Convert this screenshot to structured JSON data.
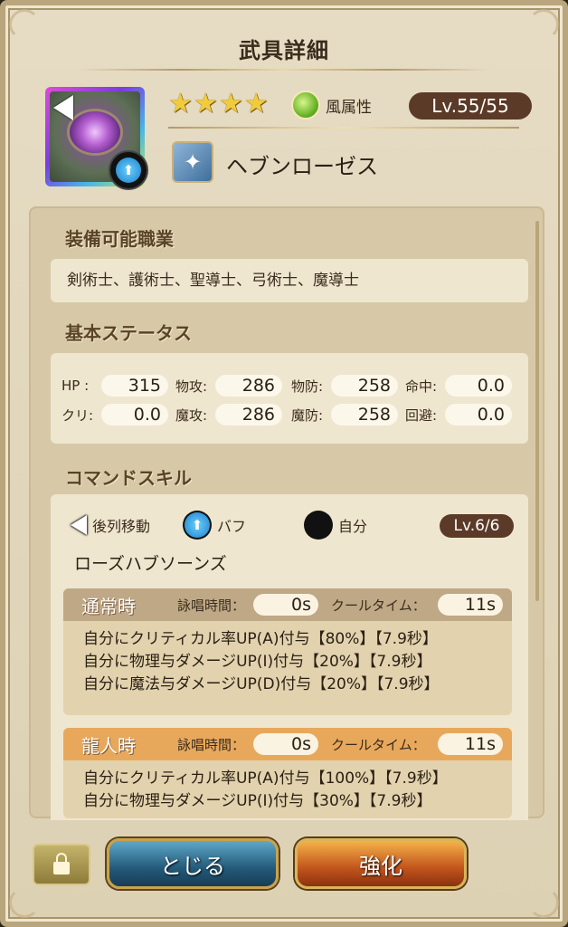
{
  "title": "武具詳細",
  "weapon": {
    "name": "ヘブンローゼス",
    "rarity_stars": 4,
    "star_glyph": "★",
    "attribute": "風属性",
    "level": "Lv.55/55",
    "icon": "rose-weapon-icon"
  },
  "sections": {
    "jobs_title": "装備可能職業",
    "stats_title": "基本ステータス",
    "skill_title": "コマンドスキル"
  },
  "jobs": "剣術士、護術士、聖導士、弓術士、魔導士",
  "stats": [
    {
      "label": "HP :",
      "value": "315"
    },
    {
      "label": "物攻:",
      "value": "286"
    },
    {
      "label": "物防:",
      "value": "258"
    },
    {
      "label": "命中:",
      "value": "0.0"
    },
    {
      "label": "クリ:",
      "value": "0.0"
    },
    {
      "label": "魔攻:",
      "value": "286"
    },
    {
      "label": "魔防:",
      "value": "258"
    },
    {
      "label": "回避:",
      "value": "0.0"
    }
  ],
  "skill": {
    "tags": [
      "後列移動",
      "バフ",
      "自分"
    ],
    "level": "Lv.6/6",
    "name": "ローズハブソーンズ",
    "cast_label": "詠唱時間：",
    "cooldown_label": "クールタイム：",
    "normal": {
      "label": "通常時",
      "cast": "0s",
      "cooldown": "11s",
      "effects": [
        "自分にクリティカル率UP(A)付与【80%】【7.9秒】",
        "自分に物理与ダメージUP(I)付与【20%】【7.9秒】",
        "自分に魔法与ダメージUP(D)付与【20%】【7.9秒】"
      ]
    },
    "dragon": {
      "label": "龍人時",
      "cast": "0s",
      "cooldown": "11s",
      "effects": [
        "自分にクリティカル率UP(A)付与【100%】【7.9秒】",
        "自分に物理与ダメージUP(I)付与【30%】【7.9秒】"
      ]
    }
  },
  "buttons": {
    "close": "とじる",
    "upgrade": "強化"
  },
  "colors": {
    "level_badge": "#5b3a28",
    "normal_header": "#bfa886",
    "dragon_header": "#e8a85c",
    "star": "#f1cb3c"
  }
}
